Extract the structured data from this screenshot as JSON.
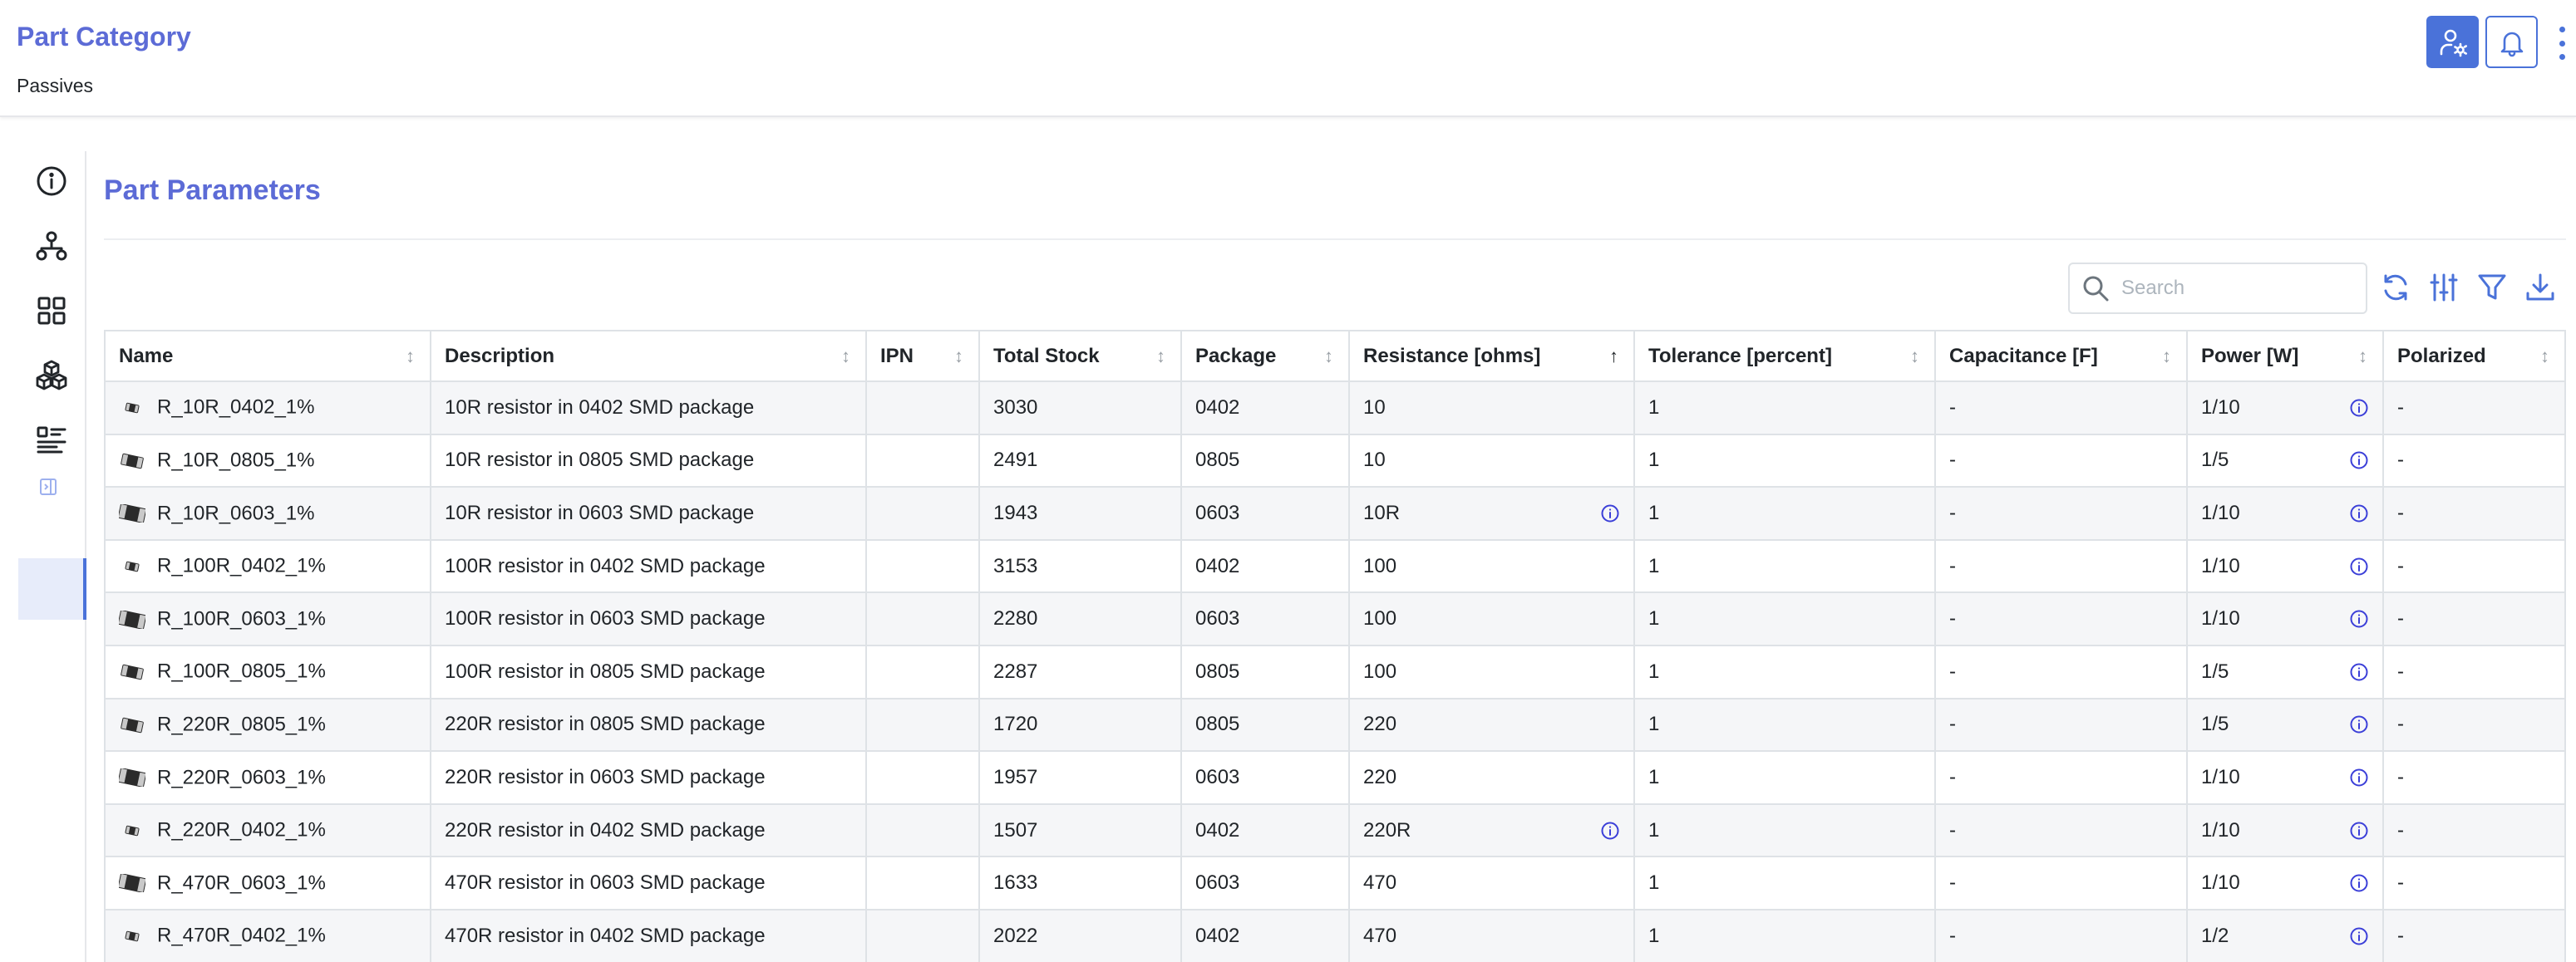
{
  "header": {
    "title": "Part Category",
    "subtitle": "Passives"
  },
  "sidebar": {
    "items": [
      {
        "icon": "info-icon"
      },
      {
        "icon": "hierarchy-icon"
      },
      {
        "icon": "grid-icon"
      },
      {
        "icon": "cubes-icon"
      },
      {
        "icon": "parameters-list-icon",
        "active": true
      },
      {
        "icon": "collapse-sidebar-icon"
      }
    ]
  },
  "panel": {
    "title": "Part Parameters",
    "search_placeholder": "Search"
  },
  "table": {
    "columns": [
      "Name",
      "Description",
      "IPN",
      "Total Stock",
      "Package",
      "Resistance [ohms]",
      "Tolerance [percent]",
      "Capacitance [F]",
      "Power [W]",
      "Polarized"
    ],
    "rows": [
      {
        "name": "R_10R_0402_1%",
        "description": "10R resistor in 0402 SMD package",
        "ipn": "",
        "stock": "3030",
        "package": "0402",
        "resistance": "10",
        "resistance_info": false,
        "tolerance": "1",
        "capacitance": "-",
        "power": "1/10",
        "polarized": "-"
      },
      {
        "name": "R_10R_0805_1%",
        "description": "10R resistor in 0805 SMD package",
        "ipn": "",
        "stock": "2491",
        "package": "0805",
        "resistance": "10",
        "resistance_info": false,
        "tolerance": "1",
        "capacitance": "-",
        "power": "1/5",
        "polarized": "-"
      },
      {
        "name": "R_10R_0603_1%",
        "description": "10R resistor in 0603 SMD package",
        "ipn": "",
        "stock": "1943",
        "package": "0603",
        "resistance": "10R",
        "resistance_info": true,
        "tolerance": "1",
        "capacitance": "-",
        "power": "1/10",
        "polarized": "-"
      },
      {
        "name": "R_100R_0402_1%",
        "description": "100R resistor in 0402 SMD package",
        "ipn": "",
        "stock": "3153",
        "package": "0402",
        "resistance": "100",
        "resistance_info": false,
        "tolerance": "1",
        "capacitance": "-",
        "power": "1/10",
        "polarized": "-"
      },
      {
        "name": "R_100R_0603_1%",
        "description": "100R resistor in 0603 SMD package",
        "ipn": "",
        "stock": "2280",
        "package": "0603",
        "resistance": "100",
        "resistance_info": false,
        "tolerance": "1",
        "capacitance": "-",
        "power": "1/10",
        "polarized": "-"
      },
      {
        "name": "R_100R_0805_1%",
        "description": "100R resistor in 0805 SMD package",
        "ipn": "",
        "stock": "2287",
        "package": "0805",
        "resistance": "100",
        "resistance_info": false,
        "tolerance": "1",
        "capacitance": "-",
        "power": "1/5",
        "polarized": "-"
      },
      {
        "name": "R_220R_0805_1%",
        "description": "220R resistor in 0805 SMD package",
        "ipn": "",
        "stock": "1720",
        "package": "0805",
        "resistance": "220",
        "resistance_info": false,
        "tolerance": "1",
        "capacitance": "-",
        "power": "1/5",
        "polarized": "-"
      },
      {
        "name": "R_220R_0603_1%",
        "description": "220R resistor in 0603 SMD package",
        "ipn": "",
        "stock": "1957",
        "package": "0603",
        "resistance": "220",
        "resistance_info": false,
        "tolerance": "1",
        "capacitance": "-",
        "power": "1/10",
        "polarized": "-"
      },
      {
        "name": "R_220R_0402_1%",
        "description": "220R resistor in 0402 SMD package",
        "ipn": "",
        "stock": "1507",
        "package": "0402",
        "resistance": "220R",
        "resistance_info": true,
        "tolerance": "1",
        "capacitance": "-",
        "power": "1/10",
        "polarized": "-"
      },
      {
        "name": "R_470R_0603_1%",
        "description": "470R resistor in 0603 SMD package",
        "ipn": "",
        "stock": "1633",
        "package": "0603",
        "resistance": "470",
        "resistance_info": false,
        "tolerance": "1",
        "capacitance": "-",
        "power": "1/10",
        "polarized": "-"
      },
      {
        "name": "R_470R_0402_1%",
        "description": "470R resistor in 0402 SMD package",
        "ipn": "",
        "stock": "2022",
        "package": "0402",
        "resistance": "470",
        "resistance_info": false,
        "tolerance": "1",
        "capacitance": "-",
        "power": "1/2",
        "polarized": "-"
      }
    ]
  },
  "colors": {
    "accent": "#5c6bd6",
    "primary_button": "#4a72d9",
    "info_icon": "#3b3fd8",
    "stripe": "#f5f6f8",
    "border": "#dee2e6"
  }
}
